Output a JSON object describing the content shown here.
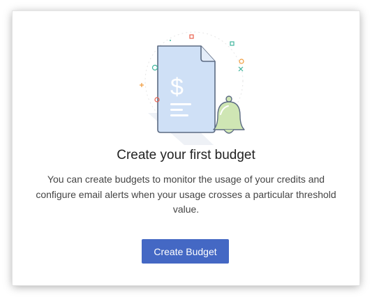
{
  "empty_state": {
    "title": "Create your first budget",
    "description": "You can create budgets to monitor the usage of your credits and configure email alerts when your usage crosses a particular threshold value.",
    "button_label": "Create Budget",
    "illustration_icons": [
      "document-dollar-icon",
      "bell-icon"
    ]
  },
  "colors": {
    "button": "#4468c4",
    "document_fill": "#cfe0f6",
    "bell_fill": "#cfe6b4",
    "accent_red": "#e8604c",
    "accent_orange": "#f09a3a",
    "accent_teal": "#3fb59d"
  }
}
